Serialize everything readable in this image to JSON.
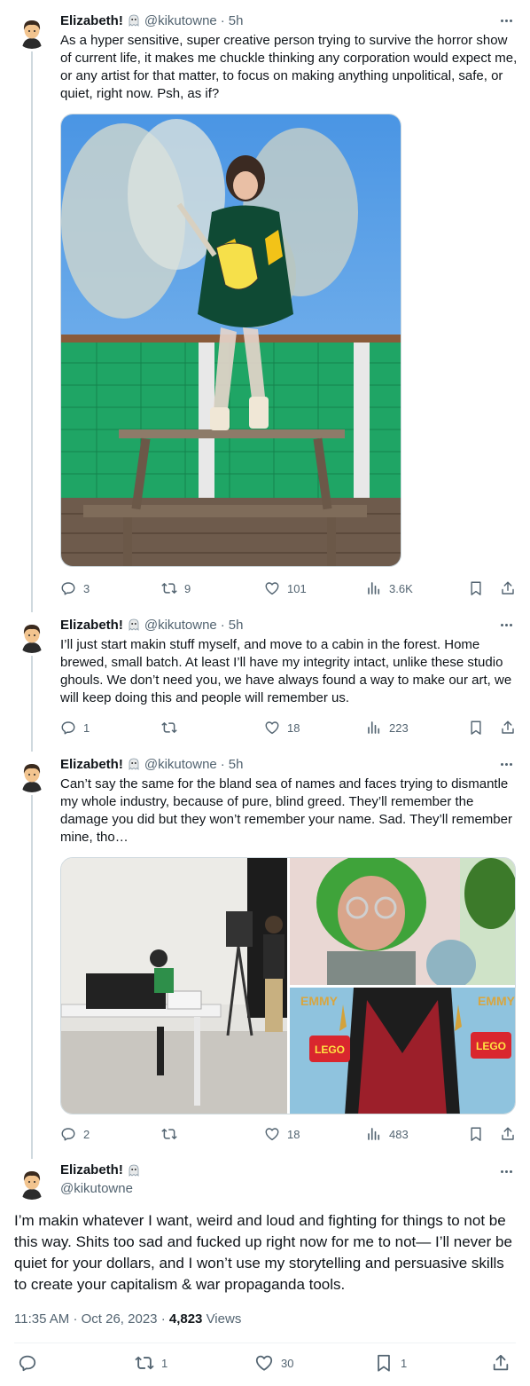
{
  "author": {
    "name": "Elizabeth!",
    "handle": "@kikutowne",
    "badge_icon": "ghost-emoji-icon"
  },
  "colors": {
    "text": "#0f1419",
    "secondary": "#536471",
    "thread_line": "#cfd9de",
    "sky": "#5aa2e6",
    "net_green": "#1fa565"
  },
  "tweets": [
    {
      "time": "5h",
      "text": "As a hyper sensitive, super creative person trying to survive the horror show of current life, it makes me chuckle thinking any corporation would expect me, or any artist for that matter, to focus on making anything unpolitical, safe, or quiet, right now. Psh, as if?",
      "actions": {
        "replies": "3",
        "reposts": "9",
        "likes": "101",
        "views": "3.6K"
      }
    },
    {
      "time": "5h",
      "text": "I’ll just start makin stuff myself, and move to a cabin in the forest. Home brewed, small batch. At least I’ll have my integrity intact, unlike these studio ghouls. We don’t need you, we have always found a way to make our art, we will keep doing this and people will remember us.",
      "actions": {
        "replies": "1",
        "reposts": "",
        "likes": "18",
        "views": "223"
      }
    },
    {
      "time": "5h",
      "text": "Can’t say the same for the bland sea of names and faces trying to dismantle my whole industry, because of pure, blind greed. They’ll remember the damage you did but they won’t remember your name. Sad. They’ll remember mine, tho…",
      "actions": {
        "replies": "2",
        "reposts": "",
        "likes": "18",
        "views": "483"
      }
    }
  ],
  "main_tweet": {
    "text": "I’m makin whatever I want, weird and loud and fighting for things to not be this way. Shits too sad and fucked up right now for me to not— I’ll never be quiet for your dollars, and I won’t use my storytelling and persuasive skills to create your capitalism & war propaganda tools.",
    "time": "11:35 AM",
    "date": "Oct 26, 2023",
    "views_count": "4,823",
    "views_label": "Views",
    "actions": {
      "replies": "",
      "reposts": "1",
      "likes": "30",
      "bookmarks": "1"
    }
  },
  "media": {
    "photo_banner_left": "EMMY",
    "photo_banner_right": "EMMY",
    "photo_logo_left": "LEGO",
    "photo_logo_right": "LEGO"
  }
}
